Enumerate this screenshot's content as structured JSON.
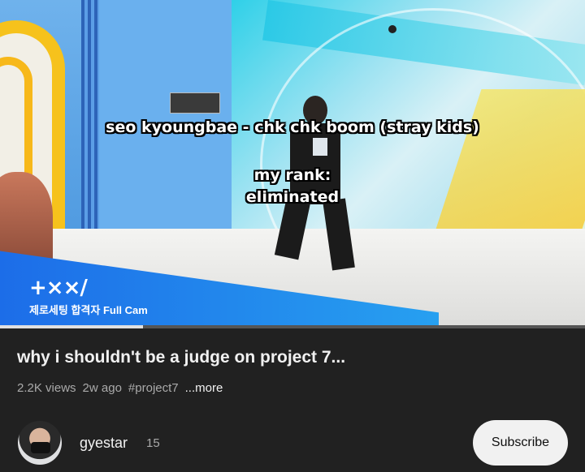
{
  "video": {
    "meme_line1": "seo kyoungbae - chk chk boom (stray kids)",
    "meme_line2a": "my rank:",
    "meme_line2b": "eliminated",
    "logo_text": "+××/",
    "logo_subtitle": "제로세팅 합격자 Full Cam",
    "progress": 0.245
  },
  "info": {
    "title": "why i shouldn't be a judge on project 7...",
    "views": "2.2K views",
    "age": "2w ago",
    "hashtag": "#project7",
    "more": "...more"
  },
  "channel": {
    "name": "gyestar",
    "subscriber_count": "15",
    "subscribe_label": "Subscribe"
  },
  "colors": {
    "background": "#212121",
    "banner": "#1c6be8",
    "accent_yellow": "#f6c21c"
  }
}
